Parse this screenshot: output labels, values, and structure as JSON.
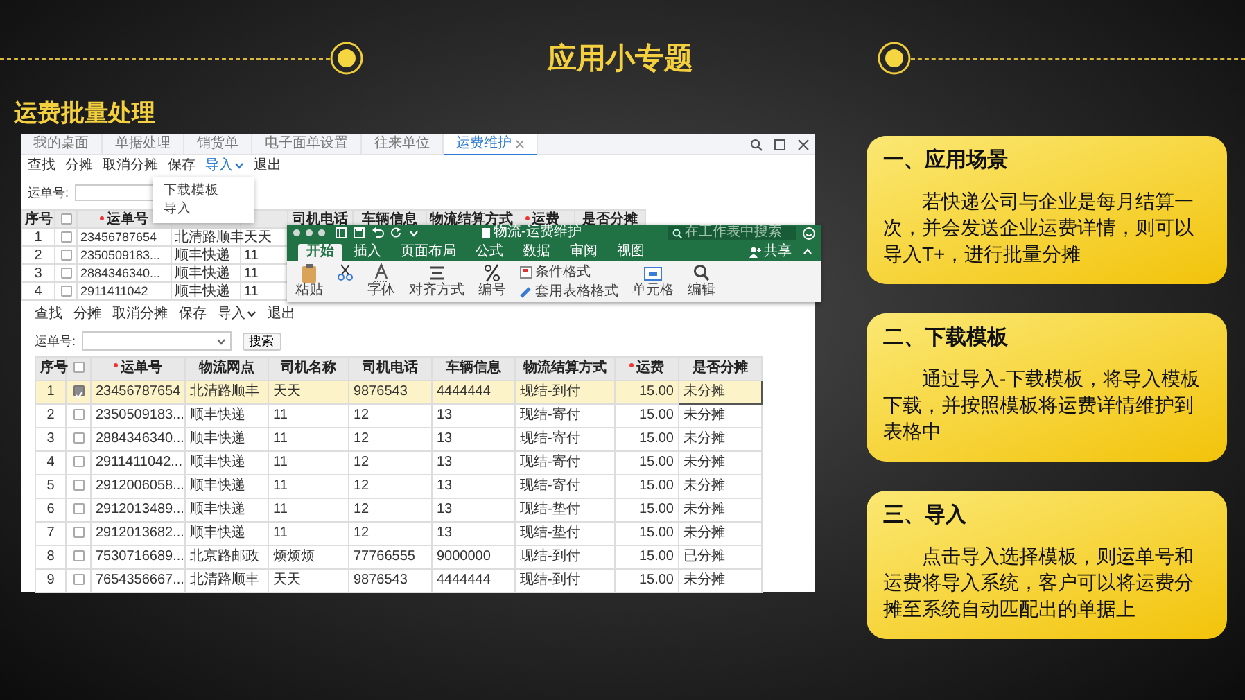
{
  "slide": {
    "title": "应用小专题",
    "subtitle": "运费批量处理"
  },
  "back_window": {
    "tabs": [
      {
        "label": "我的桌面",
        "selected": false
      },
      {
        "label": "单据处理",
        "selected": false
      },
      {
        "label": "销货单",
        "selected": false
      },
      {
        "label": "电子面单设置",
        "selected": false
      },
      {
        "label": "往来单位",
        "selected": false
      },
      {
        "label": "运费维护",
        "selected": true,
        "closable": true
      }
    ],
    "toolbar": [
      {
        "label": "查找",
        "kind": "button",
        "selected": false
      },
      {
        "label": "分摊",
        "kind": "button",
        "selected": false
      },
      {
        "label": "取消分摊",
        "kind": "button",
        "selected": false
      },
      {
        "label": "保存",
        "kind": "button",
        "selected": false
      },
      {
        "label": "导入",
        "kind": "dropdown",
        "selected": true
      },
      {
        "label": "退出",
        "kind": "button",
        "selected": false
      }
    ],
    "search_label": "运单号:",
    "header_checkbox": {
      "checked": false
    },
    "columns": [
      {
        "kind": "index",
        "label": "序号"
      },
      {
        "kind": "text",
        "label": "运单号",
        "required": true
      },
      {
        "kind": "text"
      },
      {
        "kind": "text"
      },
      {
        "kind": "text",
        "label": "司机电话"
      },
      {
        "kind": "text",
        "label": "车辆信息"
      },
      {
        "kind": "text",
        "label": "物流结算方式"
      },
      {
        "kind": "number",
        "label": "运费",
        "required": true
      },
      {
        "kind": "text",
        "label": "是否分摊"
      }
    ],
    "rows": [
      {
        "cells": [
          "1",
          "23456787654",
          "北清路顺丰",
          "天天"
        ],
        "checked": false
      },
      {
        "cells": [
          "2",
          "2350509183...",
          "顺丰快递",
          "11"
        ],
        "checked": false
      },
      {
        "cells": [
          "3",
          "2884346340...",
          "顺丰快递",
          "11"
        ],
        "checked": false
      },
      {
        "cells": [
          "4",
          "2911411042",
          "顺丰快递",
          "11"
        ],
        "checked": false
      }
    ]
  },
  "import_menu": {
    "items": [
      "下载模板",
      "导入"
    ]
  },
  "excel_window": {
    "title": "物流-运费维护",
    "search": {
      "placeholder": "在工作表中搜索"
    },
    "tabs": [
      {
        "label": "开始",
        "selected": true
      },
      {
        "label": "插入",
        "selected": false
      },
      {
        "label": "页面布局",
        "selected": false
      },
      {
        "label": "公式",
        "selected": false
      },
      {
        "label": "数据",
        "selected": false
      },
      {
        "label": "审阅",
        "selected": false
      },
      {
        "label": "视图",
        "selected": false
      }
    ],
    "share": "共享",
    "ribbon": [
      {
        "kind": "paste",
        "label": "粘贴"
      },
      {
        "kind": "clipboard"
      },
      {
        "kind": "font",
        "label": "字体"
      },
      {
        "kind": "align",
        "label": "对齐方式"
      },
      {
        "kind": "number",
        "label": "编号"
      },
      {
        "kind": "styles",
        "items": [
          "条件格式",
          "套用表格格式"
        ]
      },
      {
        "kind": "cells",
        "label": "单元格"
      },
      {
        "kind": "edit",
        "label": "编辑"
      }
    ]
  },
  "front_window": {
    "toolbar": [
      {
        "label": "查找",
        "kind": "button",
        "selected": false
      },
      {
        "label": "分摊",
        "kind": "button",
        "selected": false
      },
      {
        "label": "取消分摊",
        "kind": "button",
        "selected": false
      },
      {
        "label": "保存",
        "kind": "button",
        "selected": false
      },
      {
        "label": "导入",
        "kind": "dropdown",
        "selected": false
      },
      {
        "label": "退出",
        "kind": "button",
        "selected": false
      }
    ],
    "search": {
      "label": "运单号:",
      "button": "搜索"
    },
    "header_checkbox": {
      "checked": false
    },
    "columns": [
      {
        "kind": "index",
        "label": "序号"
      },
      {
        "kind": "text",
        "label": "运单号",
        "required": true
      },
      {
        "kind": "text",
        "label": "物流网点"
      },
      {
        "kind": "text",
        "label": "司机名称"
      },
      {
        "kind": "text",
        "label": "司机电话"
      },
      {
        "kind": "text",
        "label": "车辆信息"
      },
      {
        "kind": "text",
        "label": "物流结算方式"
      },
      {
        "kind": "number",
        "label": "运费",
        "required": true
      },
      {
        "kind": "text",
        "label": "是否分摊"
      }
    ],
    "rows": [
      {
        "cells": [
          "1",
          "23456787654",
          "北清路顺丰",
          "天天",
          "9876543",
          "4444444",
          "现结-到付",
          "15.00",
          "未分摊"
        ],
        "checked": true,
        "selected": true
      },
      {
        "cells": [
          "2",
          "2350509183...",
          "顺丰快递",
          "11",
          "12",
          "13",
          "现结-寄付",
          "15.00",
          "未分摊"
        ],
        "checked": false,
        "selected": false
      },
      {
        "cells": [
          "3",
          "2884346340...",
          "顺丰快递",
          "11",
          "12",
          "13",
          "现结-寄付",
          "15.00",
          "未分摊"
        ],
        "checked": false,
        "selected": false
      },
      {
        "cells": [
          "4",
          "2911411042...",
          "顺丰快递",
          "11",
          "12",
          "13",
          "现结-寄付",
          "15.00",
          "未分摊"
        ],
        "checked": false,
        "selected": false
      },
      {
        "cells": [
          "5",
          "2912006058...",
          "顺丰快递",
          "11",
          "12",
          "13",
          "现结-寄付",
          "15.00",
          "未分摊"
        ],
        "checked": false,
        "selected": false
      },
      {
        "cells": [
          "6",
          "2912013489...",
          "顺丰快递",
          "11",
          "12",
          "13",
          "现结-垫付",
          "15.00",
          "未分摊"
        ],
        "checked": false,
        "selected": false
      },
      {
        "cells": [
          "7",
          "2912013682...",
          "顺丰快递",
          "11",
          "12",
          "13",
          "现结-垫付",
          "15.00",
          "未分摊"
        ],
        "checked": false,
        "selected": false
      },
      {
        "cells": [
          "8",
          "7530716689...",
          "北京路邮政",
          "烦烦烦",
          "77766555",
          "9000000",
          "现结-到付",
          "15.00",
          "已分摊"
        ],
        "checked": false,
        "selected": false
      },
      {
        "cells": [
          "9",
          "7654356667...",
          "北清路顺丰",
          "天天",
          "9876543",
          "4444444",
          "现结-到付",
          "15.00",
          "未分摊"
        ],
        "checked": false,
        "selected": false
      }
    ]
  },
  "cards": [
    {
      "title": "一、应用场景",
      "text": "若快递公司与企业是每月结算一次，并会发送企业运费详情，则可以导入T+，进行批量分摊"
    },
    {
      "title": "二、下载模板",
      "text": "通过导入-下载模板，将导入模板下载，并按照模板将运费详情维护到表格中"
    },
    {
      "title": "三、导入",
      "text": "点击导入选择模板，则运单号和运费将导入系统，客户可以将运费分摊至系统自动匹配出的单据上"
    }
  ]
}
